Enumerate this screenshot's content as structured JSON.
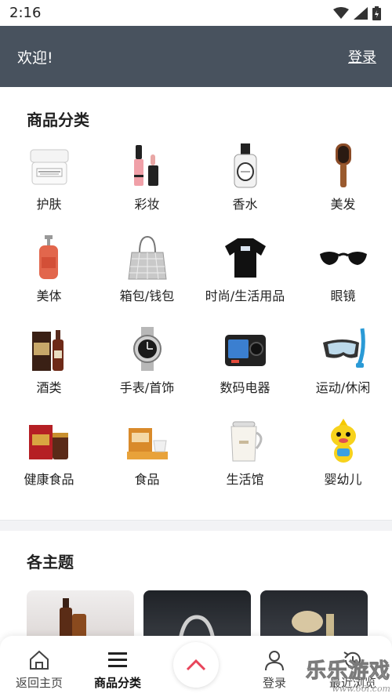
{
  "status_bar": {
    "time": "2:16"
  },
  "header": {
    "welcome": "欢迎!",
    "login": "登录"
  },
  "categories_section": {
    "title": "商品分类",
    "items": [
      {
        "label": "护肤",
        "icon": "cream-jar-icon"
      },
      {
        "label": "彩妆",
        "icon": "lip-gloss-icon"
      },
      {
        "label": "香水",
        "icon": "perfume-bottle-icon"
      },
      {
        "label": "美发",
        "icon": "hairbrush-icon"
      },
      {
        "label": "美体",
        "icon": "body-wash-bottle-icon"
      },
      {
        "label": "箱包/钱包",
        "icon": "tote-bag-icon"
      },
      {
        "label": "时尚/生活用品",
        "icon": "t-shirt-icon"
      },
      {
        "label": "眼镜",
        "icon": "sunglasses-icon"
      },
      {
        "label": "酒类",
        "icon": "liquor-bottle-icon"
      },
      {
        "label": "手表/首饰",
        "icon": "watch-icon"
      },
      {
        "label": "数码电器",
        "icon": "action-camera-icon"
      },
      {
        "label": "运动/休闲",
        "icon": "snorkel-mask-icon"
      },
      {
        "label": "健康食品",
        "icon": "ginseng-box-icon"
      },
      {
        "label": "食品",
        "icon": "tea-box-icon"
      },
      {
        "label": "生活馆",
        "icon": "kettle-icon"
      },
      {
        "label": "婴幼儿",
        "icon": "plush-toy-icon"
      }
    ]
  },
  "themes_section": {
    "title": "各主题"
  },
  "bottom_nav": {
    "home": "返回主页",
    "categories": "商品分类",
    "login": "登录",
    "history": "最近浏览"
  },
  "watermark": {
    "text": "乐乐游戏",
    "url": "www.66l.com"
  },
  "colors": {
    "header_bg": "#48525e",
    "accent": "#e8445a"
  }
}
